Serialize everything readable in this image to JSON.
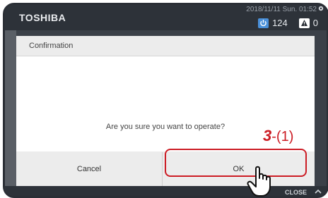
{
  "header": {
    "logo": "TOSHIBA",
    "datetime": "2018/11/11 Sun. 01:52",
    "power_count": "124",
    "alarm_count": "0"
  },
  "dialog": {
    "title": "Confirmation",
    "message": "Are you sure you want to operate?",
    "cancel_label": "Cancel",
    "ok_label": "OK"
  },
  "footer": {
    "close_label": "CLOSE"
  },
  "annotation": {
    "step_number": "3",
    "step_suffix": "-(1)",
    "color": "#cc1c24"
  },
  "icons": [
    "gear-icon",
    "power-icon",
    "alarm-icon",
    "chevron-up-icon",
    "pointing-hand-icon"
  ]
}
